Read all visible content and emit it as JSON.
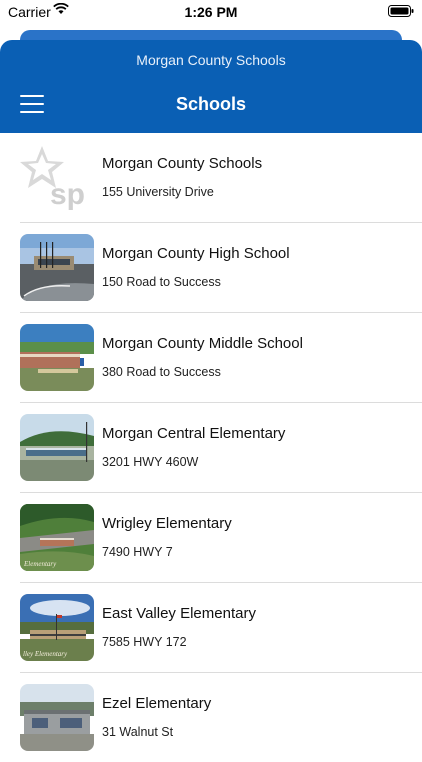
{
  "status_bar": {
    "carrier": "Carrier",
    "time": "1:26 PM"
  },
  "header": {
    "subtitle": "Morgan County Schools",
    "title": "Schools"
  },
  "schools": [
    {
      "name": "Morgan County Schools",
      "address": "155 University Drive",
      "thumb": "sp-logo"
    },
    {
      "name": "Morgan County High School",
      "address": "150 Road to Success",
      "thumb": "photo"
    },
    {
      "name": "Morgan County Middle School",
      "address": "380 Road to Success",
      "thumb": "photo"
    },
    {
      "name": "Morgan Central Elementary",
      "address": "3201 HWY 460W",
      "thumb": "photo"
    },
    {
      "name": "Wrigley Elementary",
      "address": "7490 HWY 7",
      "thumb": "photo"
    },
    {
      "name": "East Valley Elementary",
      "address": "7585 HWY 172",
      "thumb": "photo"
    },
    {
      "name": "Ezel Elementary",
      "address": "31 Walnut St",
      "thumb": "photo"
    }
  ],
  "logo_text": "sp",
  "colors": {
    "header": "#0a5fb4",
    "divider": "#dcdcdc"
  }
}
